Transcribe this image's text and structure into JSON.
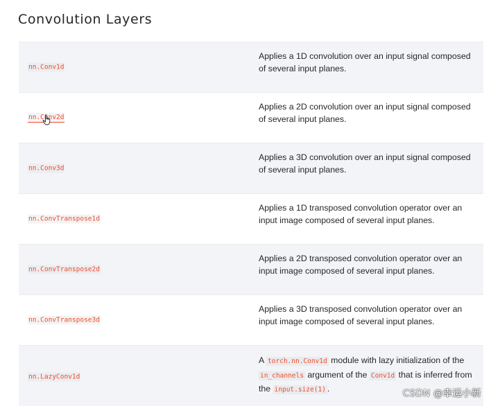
{
  "page": {
    "title": "Convolution Layers"
  },
  "rows": [
    {
      "name": "nn.Conv1d",
      "desc": "Applies a 1D convolution over an input signal composed of several input planes."
    },
    {
      "name": "nn.Conv2d",
      "desc": "Applies a 2D convolution over an input signal composed of several input planes."
    },
    {
      "name": "nn.Conv3d",
      "desc": "Applies a 3D convolution over an input signal composed of several input planes."
    },
    {
      "name": "nn.ConvTranspose1d",
      "desc": "Applies a 1D transposed convolution operator over an input image composed of several input planes."
    },
    {
      "name": "nn.ConvTranspose2d",
      "desc": "Applies a 2D transposed convolution operator over an input image composed of several input planes."
    },
    {
      "name": "nn.ConvTranspose3d",
      "desc": "Applies a 3D transposed convolution operator over an input image composed of several input planes."
    },
    {
      "name": "nn.LazyConv1d",
      "desc_parts": {
        "t1": "A",
        "c1": "torch.nn.Conv1d",
        "t2": "module with lazy initialization of the",
        "c2": "in_channels",
        "t3": "argument of the",
        "c3": "Conv1d",
        "t4": "that is inferred from the",
        "c4": "input.size(1)",
        "t5": "."
      }
    }
  ],
  "watermark": "CSDN @幸运小新",
  "colors": {
    "code_red": "#ee4c2c",
    "row_shade": "#f3f4f7",
    "text": "#262626"
  },
  "cursor": {
    "icon": "hand-pointer-icon"
  }
}
